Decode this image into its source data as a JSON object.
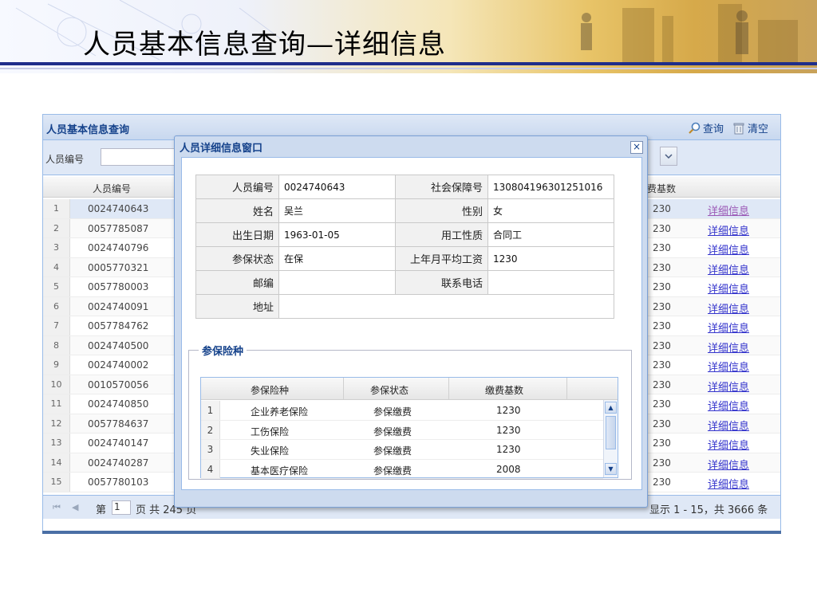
{
  "slide": {
    "title": "人员基本信息查询—详细信息"
  },
  "panel": {
    "title": "人员基本信息查询",
    "toolbar": {
      "query": "查询",
      "clear": "清空"
    },
    "search": {
      "label": "人员编号",
      "value": ""
    },
    "grid": {
      "col_id": "人员编号",
      "col_amount": "费基数",
      "rows": [
        {
          "n": "1",
          "id": "0024740643",
          "amount": "230",
          "link": "详细信息"
        },
        {
          "n": "2",
          "id": "0057785087",
          "amount": "230",
          "link": "详细信息"
        },
        {
          "n": "3",
          "id": "0024740796",
          "amount": "230",
          "link": "详细信息"
        },
        {
          "n": "4",
          "id": "0005770321",
          "amount": "230",
          "link": "详细信息"
        },
        {
          "n": "5",
          "id": "0057780003",
          "amount": "230",
          "link": "详细信息"
        },
        {
          "n": "6",
          "id": "0024740091",
          "amount": "230",
          "link": "详细信息"
        },
        {
          "n": "7",
          "id": "0057784762",
          "amount": "230",
          "link": "详细信息"
        },
        {
          "n": "8",
          "id": "0024740500",
          "amount": "230",
          "link": "详细信息"
        },
        {
          "n": "9",
          "id": "0024740002",
          "amount": "230",
          "link": "详细信息"
        },
        {
          "n": "10",
          "id": "0010570056",
          "amount": "230",
          "link": "详细信息"
        },
        {
          "n": "11",
          "id": "0024740850",
          "amount": "230",
          "link": "详细信息"
        },
        {
          "n": "12",
          "id": "0057784637",
          "amount": "230",
          "link": "详细信息"
        },
        {
          "n": "13",
          "id": "0024740147",
          "amount": "230",
          "link": "详细信息"
        },
        {
          "n": "14",
          "id": "0024740287",
          "amount": "230",
          "link": "详细信息"
        },
        {
          "n": "15",
          "id": "0057780103",
          "amount": "230",
          "link": "详细信息"
        }
      ]
    },
    "paging": {
      "page_prefix": "第",
      "page_value": "1",
      "page_suffix": "页 共 245 页",
      "display": "显示 1 - 15，共 3666 条"
    }
  },
  "window": {
    "title": "人员详细信息窗口",
    "close": "×",
    "info": {
      "person_id_label": "人员编号",
      "person_id": "0024740643",
      "ss_no_label": "社会保障号",
      "ss_no": "130804196301251016",
      "name_label": "姓名",
      "name": "吴兰",
      "gender_label": "性别",
      "gender": "女",
      "birth_label": "出生日期",
      "birth": "1963-01-05",
      "emp_type_label": "用工性质",
      "emp_type": "合同工",
      "status_label": "参保状态",
      "status": "在保",
      "avg_wage_label": "上年月平均工资",
      "avg_wage": "1230",
      "postcode_label": "邮编",
      "postcode": "",
      "phone_label": "联系电话",
      "phone": "",
      "address_label": "地址",
      "address": ""
    },
    "insurance": {
      "legend": "参保险种",
      "col_type": "参保险种",
      "col_status": "参保状态",
      "col_base": "缴费基数",
      "rows": [
        {
          "n": "1",
          "type": "企业养老保险",
          "status": "参保缴费",
          "base": "1230"
        },
        {
          "n": "2",
          "type": "工伤保险",
          "status": "参保缴费",
          "base": "1230"
        },
        {
          "n": "3",
          "type": "失业保险",
          "status": "参保缴费",
          "base": "1230"
        },
        {
          "n": "4",
          "type": "基本医疗保险",
          "status": "参保缴费",
          "base": "2008"
        }
      ]
    }
  }
}
